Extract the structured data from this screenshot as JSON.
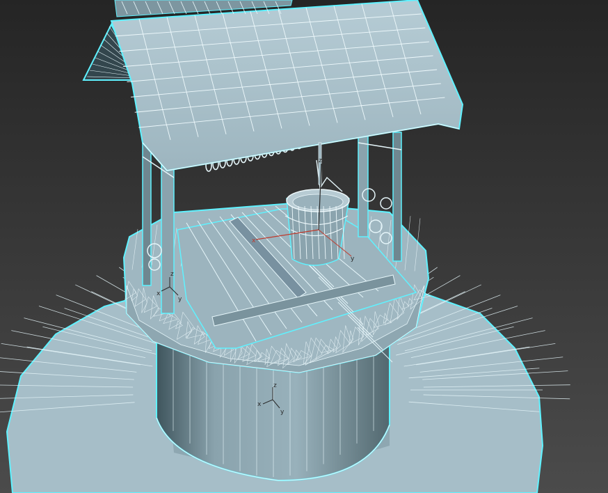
{
  "viewport": {
    "colors": {
      "background_top": "#262626",
      "background_bottom": "#4a4a4a",
      "mesh_fill": "#a9c1cb",
      "mesh_fill_dark": "#6f8790",
      "mesh_shadow": "#4d636b",
      "wire": "#e6f6fa",
      "selection_outline": "#5ff2ff",
      "gizmo_x": "#c0392b",
      "gizmo_y": "#2e7d32",
      "gizmo_z": "#2a2a2a"
    },
    "objects": [
      {
        "name": "roof",
        "icon": "roof-mesh"
      },
      {
        "name": "roof-ridge-trim",
        "icon": "rope-trim"
      },
      {
        "name": "support-posts",
        "icon": "post"
      },
      {
        "name": "rope-coils",
        "icon": "rope"
      },
      {
        "name": "bucket",
        "icon": "bucket"
      },
      {
        "name": "well-lid",
        "icon": "planks"
      },
      {
        "name": "stone-rim",
        "icon": "stones"
      },
      {
        "name": "well-shaft",
        "icon": "cylinder"
      },
      {
        "name": "ground-disc",
        "icon": "disc"
      }
    ],
    "gizmos": {
      "bucket": {
        "x": "x",
        "y": "y",
        "z": "z"
      },
      "post": {
        "x": "x",
        "y": "y",
        "z": "z"
      },
      "shaft": {
        "x": "x",
        "y": "y",
        "z": "z"
      }
    }
  }
}
